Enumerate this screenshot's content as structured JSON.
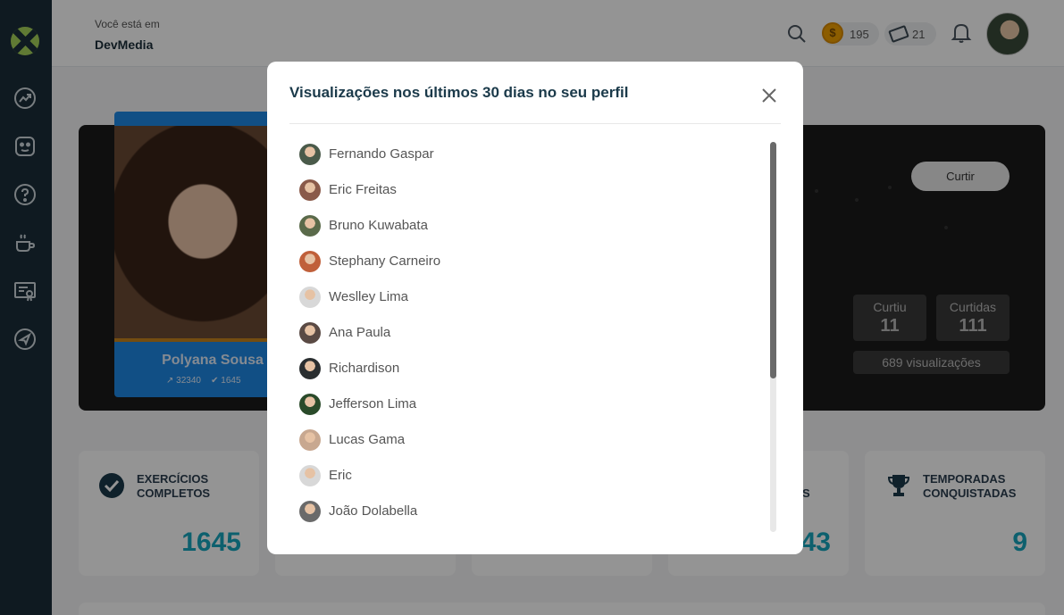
{
  "header": {
    "breadcrumb_label": "Você está em",
    "breadcrumb_title": "DevMedia",
    "coins": "195",
    "coin_symbol": "$",
    "tickets": "21"
  },
  "sidebar": {
    "items": [
      {
        "icon": "chart-icon"
      },
      {
        "icon": "robot-icon"
      },
      {
        "icon": "help-icon"
      },
      {
        "icon": "coffee-icon"
      },
      {
        "icon": "certificate-icon"
      },
      {
        "icon": "send-icon"
      }
    ]
  },
  "profile": {
    "name": "Polyana Sousa",
    "points": "32340",
    "exercises": "1645"
  },
  "hero": {
    "like_button": "Curtir",
    "curtiu_label": "Curtiu",
    "curtiu_value": "11",
    "curtidas_label": "Curtidas",
    "curtidas_value": "111",
    "views": "689 visualizações"
  },
  "cards": [
    {
      "title_line1": "EXERCÍCIOS",
      "title_line2": "COMPLETOS",
      "value": "1645",
      "icon": "check-circle-icon"
    },
    {
      "title_line1": "",
      "title_line2": "",
      "value": "",
      "icon": ""
    },
    {
      "title_line1": "",
      "title_line2": "",
      "value": "",
      "icon": ""
    },
    {
      "title_line1": "",
      "title_line2": "S",
      "value": "43",
      "icon": ""
    },
    {
      "title_line1": "TEMPORADAS",
      "title_line2": "CONQUISTADAS",
      "value": "9",
      "icon": "trophy-icon"
    }
  ],
  "modal": {
    "title": "Visualizações nos últimos 30 dias no seu perfil",
    "viewers": [
      {
        "name": "Fernando Gaspar",
        "avatar_color": "#4a5a4a"
      },
      {
        "name": "Eric Freitas",
        "avatar_color": "#8a5a4a"
      },
      {
        "name": "Bruno Kuwabata",
        "avatar_color": "#5a6a4a"
      },
      {
        "name": "Stephany Carneiro",
        "avatar_color": "#c0603a"
      },
      {
        "name": "Weslley Lima",
        "avatar_color": "#d8d8d8"
      },
      {
        "name": "Ana Paula",
        "avatar_color": "#5a4a44"
      },
      {
        "name": "Richardison",
        "avatar_color": "#2a2e30"
      },
      {
        "name": "Jefferson Lima",
        "avatar_color": "#2a4a2a"
      },
      {
        "name": "Lucas Gama",
        "avatar_color": "#c8a890"
      },
      {
        "name": "Eric",
        "avatar_color": "#d8d8d8"
      },
      {
        "name": "João Dolabella",
        "avatar_color": "#6a6a6a"
      }
    ]
  }
}
